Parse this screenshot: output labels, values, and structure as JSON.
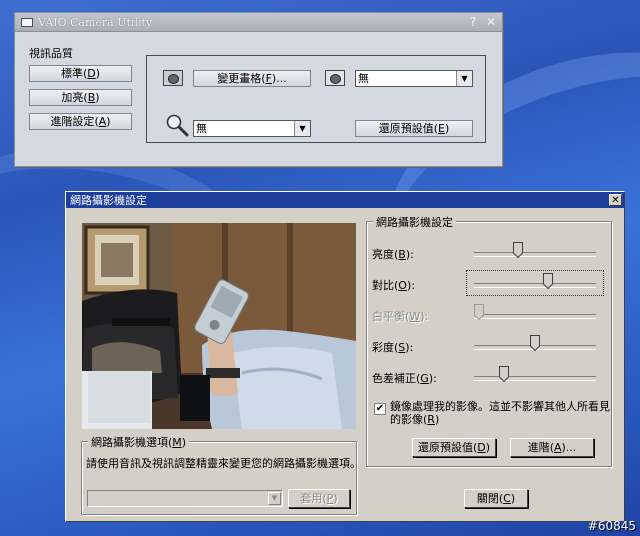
{
  "vaio": {
    "title": "VAIO Camera Utility",
    "help_glyph": "?",
    "close_glyph": "✕",
    "section_label": "視訊品質",
    "buttons": {
      "standard": {
        "text": "標準",
        "key": "D"
      },
      "brighten": {
        "text": "加亮",
        "key": "B"
      },
      "advanced": {
        "text": "進階設定",
        "key": "A"
      },
      "change_style": {
        "text": "變更畫格",
        "key": "F",
        "suffix": "..."
      },
      "restore": {
        "text": "還原預設值",
        "key": "E"
      }
    },
    "combo_frame": "無",
    "combo_zoom": "無"
  },
  "dialog": {
    "title": "網路攝影機設定",
    "close_glyph": "✕",
    "settings_group": "網路攝影機設定",
    "sliders": [
      {
        "label": "亮度",
        "key": "B",
        "enabled": true,
        "level": 0.35
      },
      {
        "label": "對比",
        "key": "O",
        "enabled": true,
        "level": 0.62
      },
      {
        "label": "白平衡",
        "key": "W",
        "enabled": false,
        "level": 0.0
      },
      {
        "label": "彩度",
        "key": "S",
        "enabled": true,
        "level": 0.5
      },
      {
        "label": "色差補正",
        "key": "G",
        "enabled": true,
        "level": 0.22
      }
    ],
    "mirror": {
      "checked": true,
      "check_glyph": "✔",
      "line1": "鏡像處理我的影像。這並不影響其他人所看見",
      "line2": "的影像",
      "key": "R"
    },
    "restore_button": {
      "text": "還原預設值",
      "key": "D"
    },
    "advanced_button": {
      "text": "進階",
      "key": "A",
      "suffix": "..."
    },
    "options_group": {
      "text": "網路攝影機選項",
      "key": "M"
    },
    "options_hint": "請使用音訊及視訊調整精靈來變更您的網路攝影機選項。",
    "options_combo_value": "",
    "apply_button": {
      "text": "套用",
      "key": "P"
    },
    "close_button": {
      "text": "關閉",
      "key": "C"
    }
  },
  "watermark": "#60845"
}
